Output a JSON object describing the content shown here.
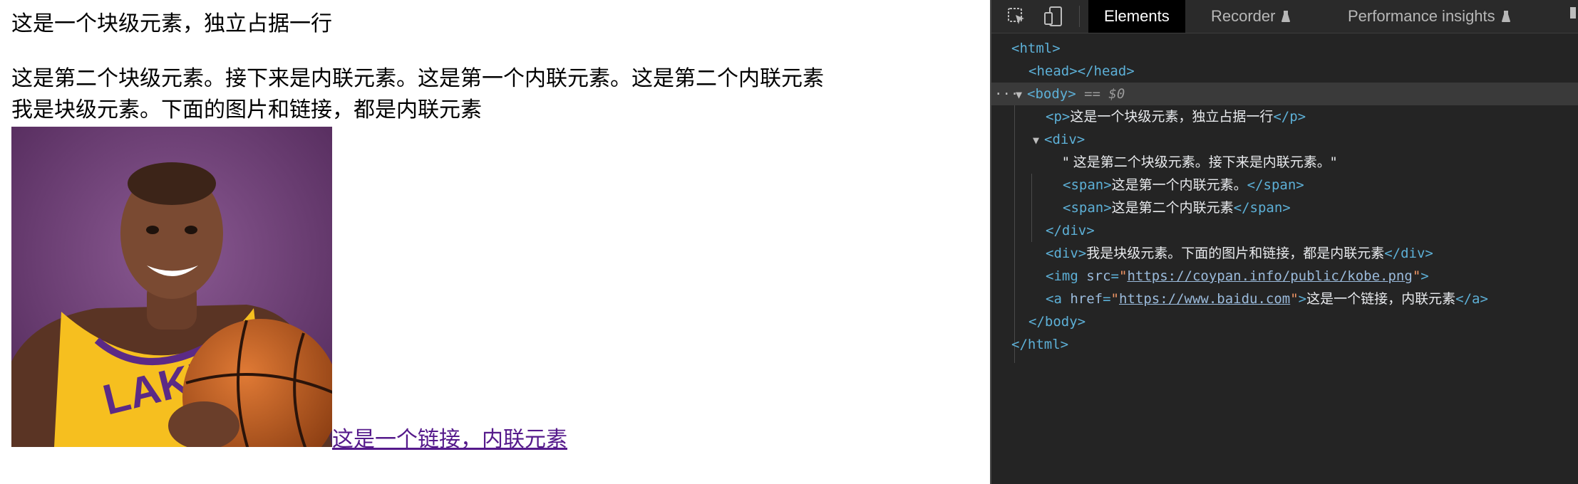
{
  "page": {
    "p_text": "这是一个块级元素，独立占据一行",
    "div_line1": "这是第二个块级元素。接下来是内联元素。这是第一个内联元素。这是第二个内联元素",
    "div_line2": "我是块级元素。下面的图片和链接，都是内联元素",
    "link_text": "这是一个链接，内联元素"
  },
  "devtools": {
    "tabs": [
      {
        "label": "Elements",
        "active": true
      },
      {
        "label": "Recorder",
        "experimental": true
      },
      {
        "label": "Performance insights",
        "experimental": true
      }
    ],
    "tree": {
      "html_open": "<html>",
      "head": "<head></head>",
      "body_open": "<body>",
      "selected_marker": "== $0",
      "p_open": "<p>",
      "p_text": "这是一个块级元素，独立占据一行",
      "p_close": "</p>",
      "div_open": "<div>",
      "div_text": "\" 这是第二个块级元素。接下来是内联元素。\"",
      "span_open": "<span>",
      "span1_text": "这是第一个内联元素。",
      "span_close": "</span>",
      "span2_text": "这是第二个内联元素",
      "div_close": "</div>",
      "div2_text": "我是块级元素。下面的图片和链接，都是内联元素",
      "img_open": "<img ",
      "src_attr": "src",
      "img_src": "https://coypan.info/public/kobe.png",
      "a_open": "<a ",
      "href_attr": "href",
      "a_href": "https://www.baidu.com",
      "a_text": "这是一个链接，内联元素",
      "a_close": "</a>",
      "body_close": "</body>",
      "html_close": "</html>"
    }
  },
  "colors": {
    "link_visited": "#551a8b",
    "devtools_bg": "#242424",
    "tag": "#5db0d7"
  }
}
